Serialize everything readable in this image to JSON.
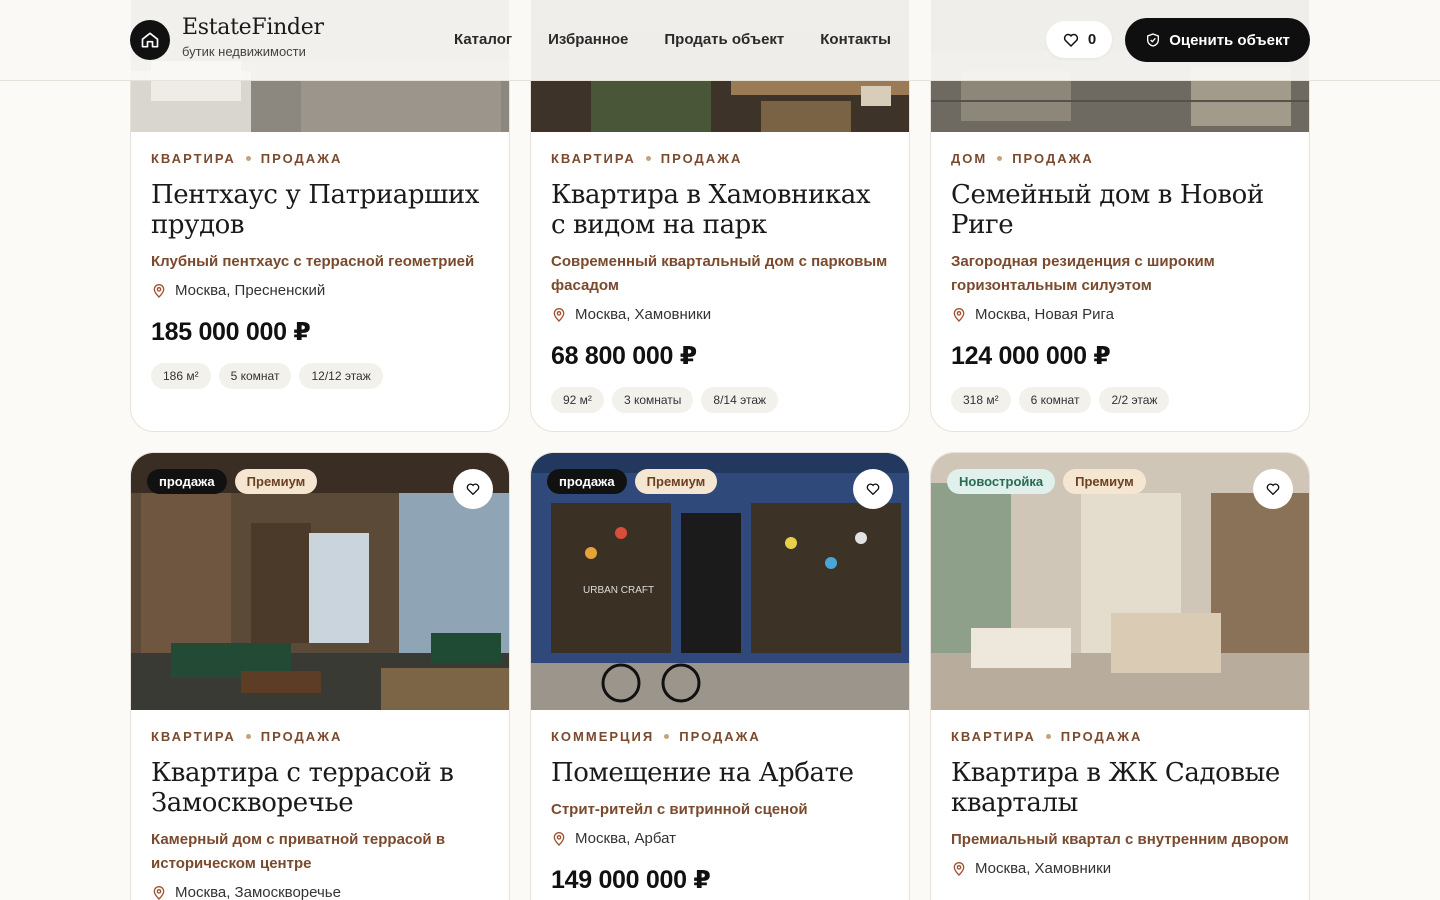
{
  "brand": {
    "name": "EstateFinder",
    "tagline": "бутик недвижимости"
  },
  "nav": [
    "Каталог",
    "Избранное",
    "Продать объект",
    "Контакты"
  ],
  "favorites": {
    "count": "0"
  },
  "cta": {
    "label": "Оценить объект"
  },
  "listings": [
    {
      "type": "квартира",
      "deal": "продажа",
      "title": "Пентхаус у Патриарших прудов",
      "subtitle": "Клубный пентхаус с террасной геометрией",
      "location": "Москва, Пресненский",
      "price": "185 000 000 ₽",
      "tags": [
        "186 м²",
        "5 комнат",
        "12/12 этаж"
      ]
    },
    {
      "type": "квартира",
      "deal": "продажа",
      "title": "Квартира в Хамовниках с видом на парк",
      "subtitle": "Современный квартальный дом с парковым фасадом",
      "location": "Москва, Хамовники",
      "price": "68 800 000 ₽",
      "tags": [
        "92 м²",
        "3 комнаты",
        "8/14 этаж"
      ]
    },
    {
      "type": "дом",
      "deal": "продажа",
      "title": "Семейный дом в Новой Риге",
      "subtitle": "Загородная резиденция с широким горизонтальным силуэтом",
      "location": "Москва, Новая Рига",
      "price": "124 000 000 ₽",
      "tags": [
        "318 м²",
        "6 комнат",
        "2/2 этаж"
      ]
    },
    {
      "badges": [
        "продажа",
        "Премиум"
      ],
      "type": "квартира",
      "deal": "продажа",
      "title": "Квартира с террасой в Замоскворечье",
      "subtitle": "Камерный дом с приватной террасой в историческом центре",
      "location": "Москва, Замоскворечье"
    },
    {
      "badges": [
        "продажа",
        "Премиум"
      ],
      "type": "коммерция",
      "deal": "продажа",
      "title": "Помещение на Арбате",
      "subtitle": "Стрит-ритейл с витринной сценой",
      "location": "Москва, Арбат",
      "price": "149 000 000 ₽",
      "image_text": "URBAN CRAFT"
    },
    {
      "badges": [
        "Новостройка",
        "Премиум"
      ],
      "type": "квартира",
      "deal": "продажа",
      "title": "Квартира в ЖК Садовые кварталы",
      "subtitle": "Премиальный квартал с внутренним двором",
      "location": "Москва, Хамовники"
    }
  ]
}
